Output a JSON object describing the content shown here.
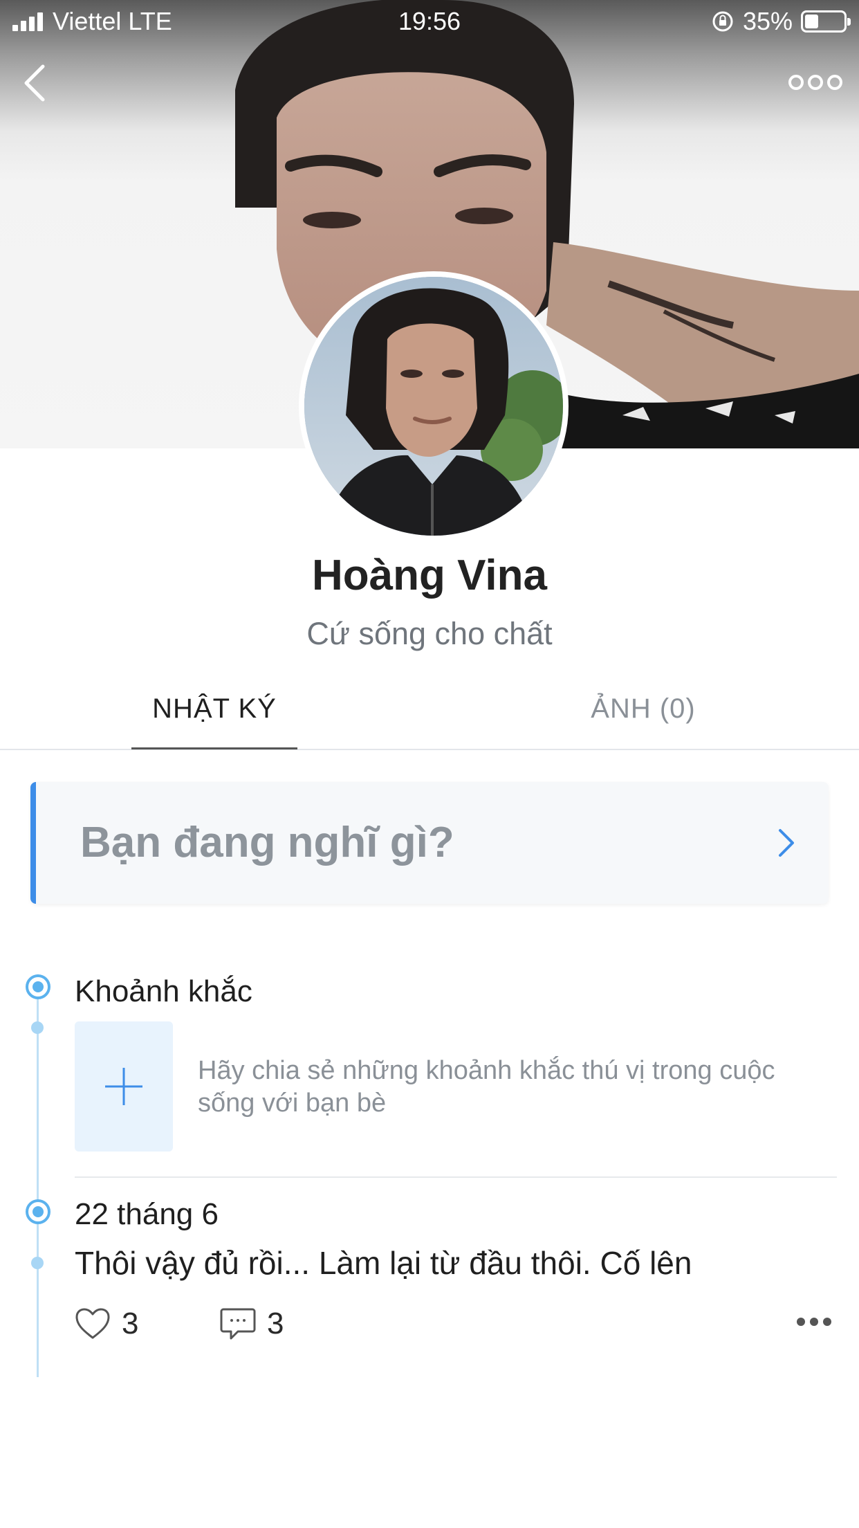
{
  "status_bar": {
    "carrier": "Viettel",
    "network": "LTE",
    "time": "19:56",
    "battery_percent": "35%",
    "battery_level": 0.35
  },
  "nav": {
    "back_icon": "chevron-left-icon",
    "more_icon": "more-horizontal-icon"
  },
  "profile": {
    "name": "Hoàng Vina",
    "status": "Cứ sống cho chất"
  },
  "tabs": [
    {
      "label": "NHẬT KÝ",
      "active": true
    },
    {
      "label": "ẢNH (0)",
      "active": false
    }
  ],
  "compose": {
    "placeholder": "Bạn đang nghĩ gì?"
  },
  "moments": {
    "title": "Khoảnh khắc",
    "hint": "Hãy chia sẻ những khoảnh khắc thú vị trong cuộc sống với bạn bè"
  },
  "post": {
    "date": "22 tháng 6",
    "text": "Thôi vậy đủ rồi... Làm lại từ đầu thôi. Cố lên",
    "likes": "3",
    "comments": "3"
  },
  "colors": {
    "accent": "#3d8de8",
    "timeline": "#5bb2ee",
    "muted_text": "#8a9097"
  }
}
